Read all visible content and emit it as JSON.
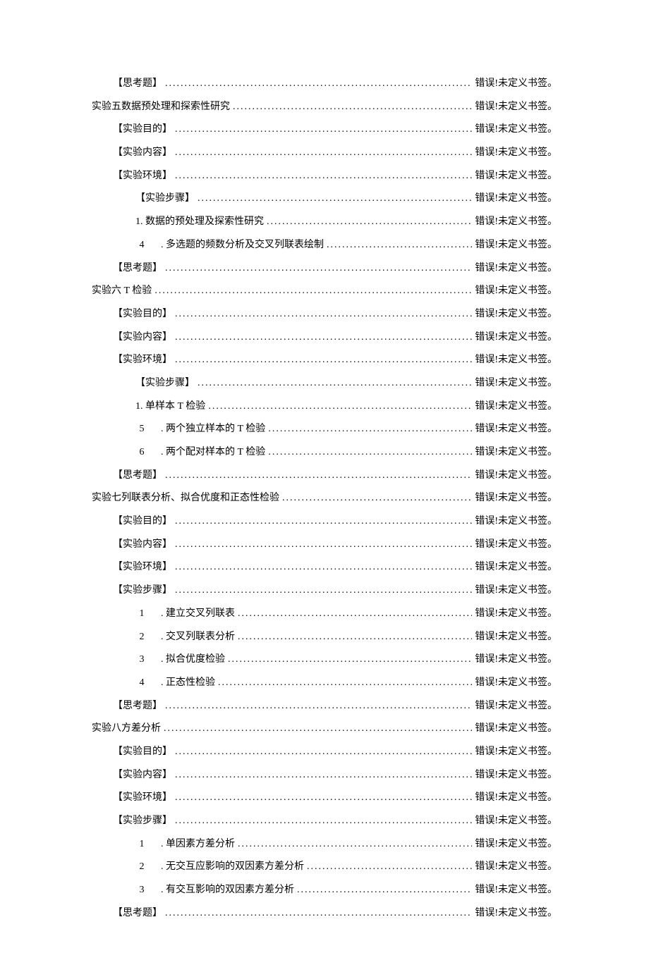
{
  "error_text": "错误!未定义书签。",
  "entries": [
    {
      "level": 1,
      "title": "【思考题】"
    },
    {
      "level": 0,
      "title": "实验五数据预处理和探索性研究"
    },
    {
      "level": 1,
      "title": "【实验目的】"
    },
    {
      "level": 1,
      "title": "【实验内容】"
    },
    {
      "level": 1,
      "title": "【实验环境】"
    },
    {
      "level": 2,
      "title": "【实验步骤】"
    },
    {
      "level": 2,
      "title": "1. 数据的预处理及探索性研究"
    },
    {
      "level": 3,
      "num": "4",
      "title": ". 多选题的频数分析及交叉列联表绘制"
    },
    {
      "level": 1,
      "title": "【思考题】"
    },
    {
      "level": 0,
      "title": "实验六 T 检验"
    },
    {
      "level": 1,
      "title": "【实验目的】"
    },
    {
      "level": 1,
      "title": "【实验内容】"
    },
    {
      "level": 1,
      "title": "【实验环境】"
    },
    {
      "level": 2,
      "title": "【实验步骤】"
    },
    {
      "level": 2,
      "title": "1. 单样本 T 检验"
    },
    {
      "level": 3,
      "num": "5",
      "title": ". 两个独立样本的 T 检验"
    },
    {
      "level": 3,
      "num": "6",
      "title": ". 两个配对样本的 T 检验"
    },
    {
      "level": 1,
      "title": "【思考题】"
    },
    {
      "level": 0,
      "title": "实验七列联表分析、拟合优度和正态性检验"
    },
    {
      "level": 1,
      "title": "【实验目的】"
    },
    {
      "level": 1,
      "title": "【实验内容】"
    },
    {
      "level": 1,
      "title": "【实验环境】"
    },
    {
      "level": 1,
      "title": "【实验步骤】"
    },
    {
      "level": 3,
      "num": "1",
      "title": ". 建立交叉列联表"
    },
    {
      "level": 3,
      "num": "2",
      "title": ". 交叉列联表分析"
    },
    {
      "level": 3,
      "num": "3",
      "title": ". 拟合优度检验"
    },
    {
      "level": 3,
      "num": "4",
      "title": ". 正态性检验"
    },
    {
      "level": 1,
      "title": "【思考题】"
    },
    {
      "level": 0,
      "title": "实验八方差分析"
    },
    {
      "level": 1,
      "title": "【实验目的】"
    },
    {
      "level": 1,
      "title": "【实验内容】"
    },
    {
      "level": 1,
      "title": "【实验环境】"
    },
    {
      "level": 1,
      "title": "【实验步骤】"
    },
    {
      "level": 3,
      "num": "1",
      "title": ". 单因素方差分析"
    },
    {
      "level": 3,
      "num": "2",
      "title": ". 无交互应影响的双因素方差分析"
    },
    {
      "level": 3,
      "num": "3",
      "title": ". 有交互影响的双因素方差分析"
    },
    {
      "level": 1,
      "title": "【思考题】"
    }
  ]
}
